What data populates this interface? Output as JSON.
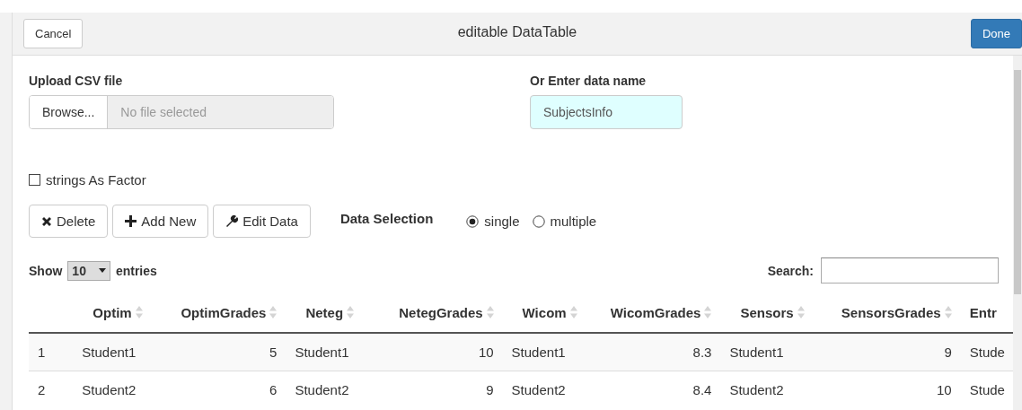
{
  "dialog": {
    "title": "editable DataTable",
    "cancel": "Cancel",
    "done": "Done"
  },
  "upload": {
    "label": "Upload CSV file",
    "browse": "Browse...",
    "placeholder": "No file selected"
  },
  "data_name": {
    "label": "Or Enter data name",
    "value": "SubjectsInfo"
  },
  "strings_as_factor": {
    "label": "strings As Factor",
    "checked": false
  },
  "actions": [
    {
      "label": "Delete",
      "kind": "delete"
    },
    {
      "label": "Add New",
      "kind": "add"
    },
    {
      "label": "Edit Data",
      "kind": "edit"
    }
  ],
  "data_selection": {
    "label": "Data Selection",
    "options": [
      {
        "label": "single",
        "selected": true
      },
      {
        "label": "multiple",
        "selected": false
      }
    ]
  },
  "length": {
    "show": "Show",
    "value": "10",
    "entries": "entries"
  },
  "search": {
    "label": "Search:"
  },
  "table": {
    "columns": [
      {
        "kind": "text"
      },
      {
        "label": "Optim",
        "sortable": true,
        "kind": "text"
      },
      {
        "label": "OptimGrades",
        "sortable": true,
        "kind": "number"
      },
      {
        "label": "Neteg",
        "sortable": true,
        "kind": "text"
      },
      {
        "label": "NetegGrades",
        "sortable": true,
        "kind": "number"
      },
      {
        "label": "Wicom",
        "sortable": true,
        "kind": "text"
      },
      {
        "label": "WicomGrades",
        "sortable": true,
        "kind": "number"
      },
      {
        "label": "Sensors",
        "sortable": true,
        "kind": "text"
      },
      {
        "label": "SensorsGrades",
        "sortable": true,
        "kind": "number"
      },
      {
        "label": "Entr",
        "sortable": false,
        "kind": "text"
      }
    ],
    "rows": [
      [
        "1",
        "Student1",
        "5",
        "Student1",
        "10",
        "Student1",
        "8.3",
        "Student1",
        "9",
        "Stude"
      ],
      [
        "2",
        "Student2",
        "6",
        "Student2",
        "9",
        "Student2",
        "8.4",
        "Student2",
        "10",
        "Stude"
      ]
    ]
  }
}
